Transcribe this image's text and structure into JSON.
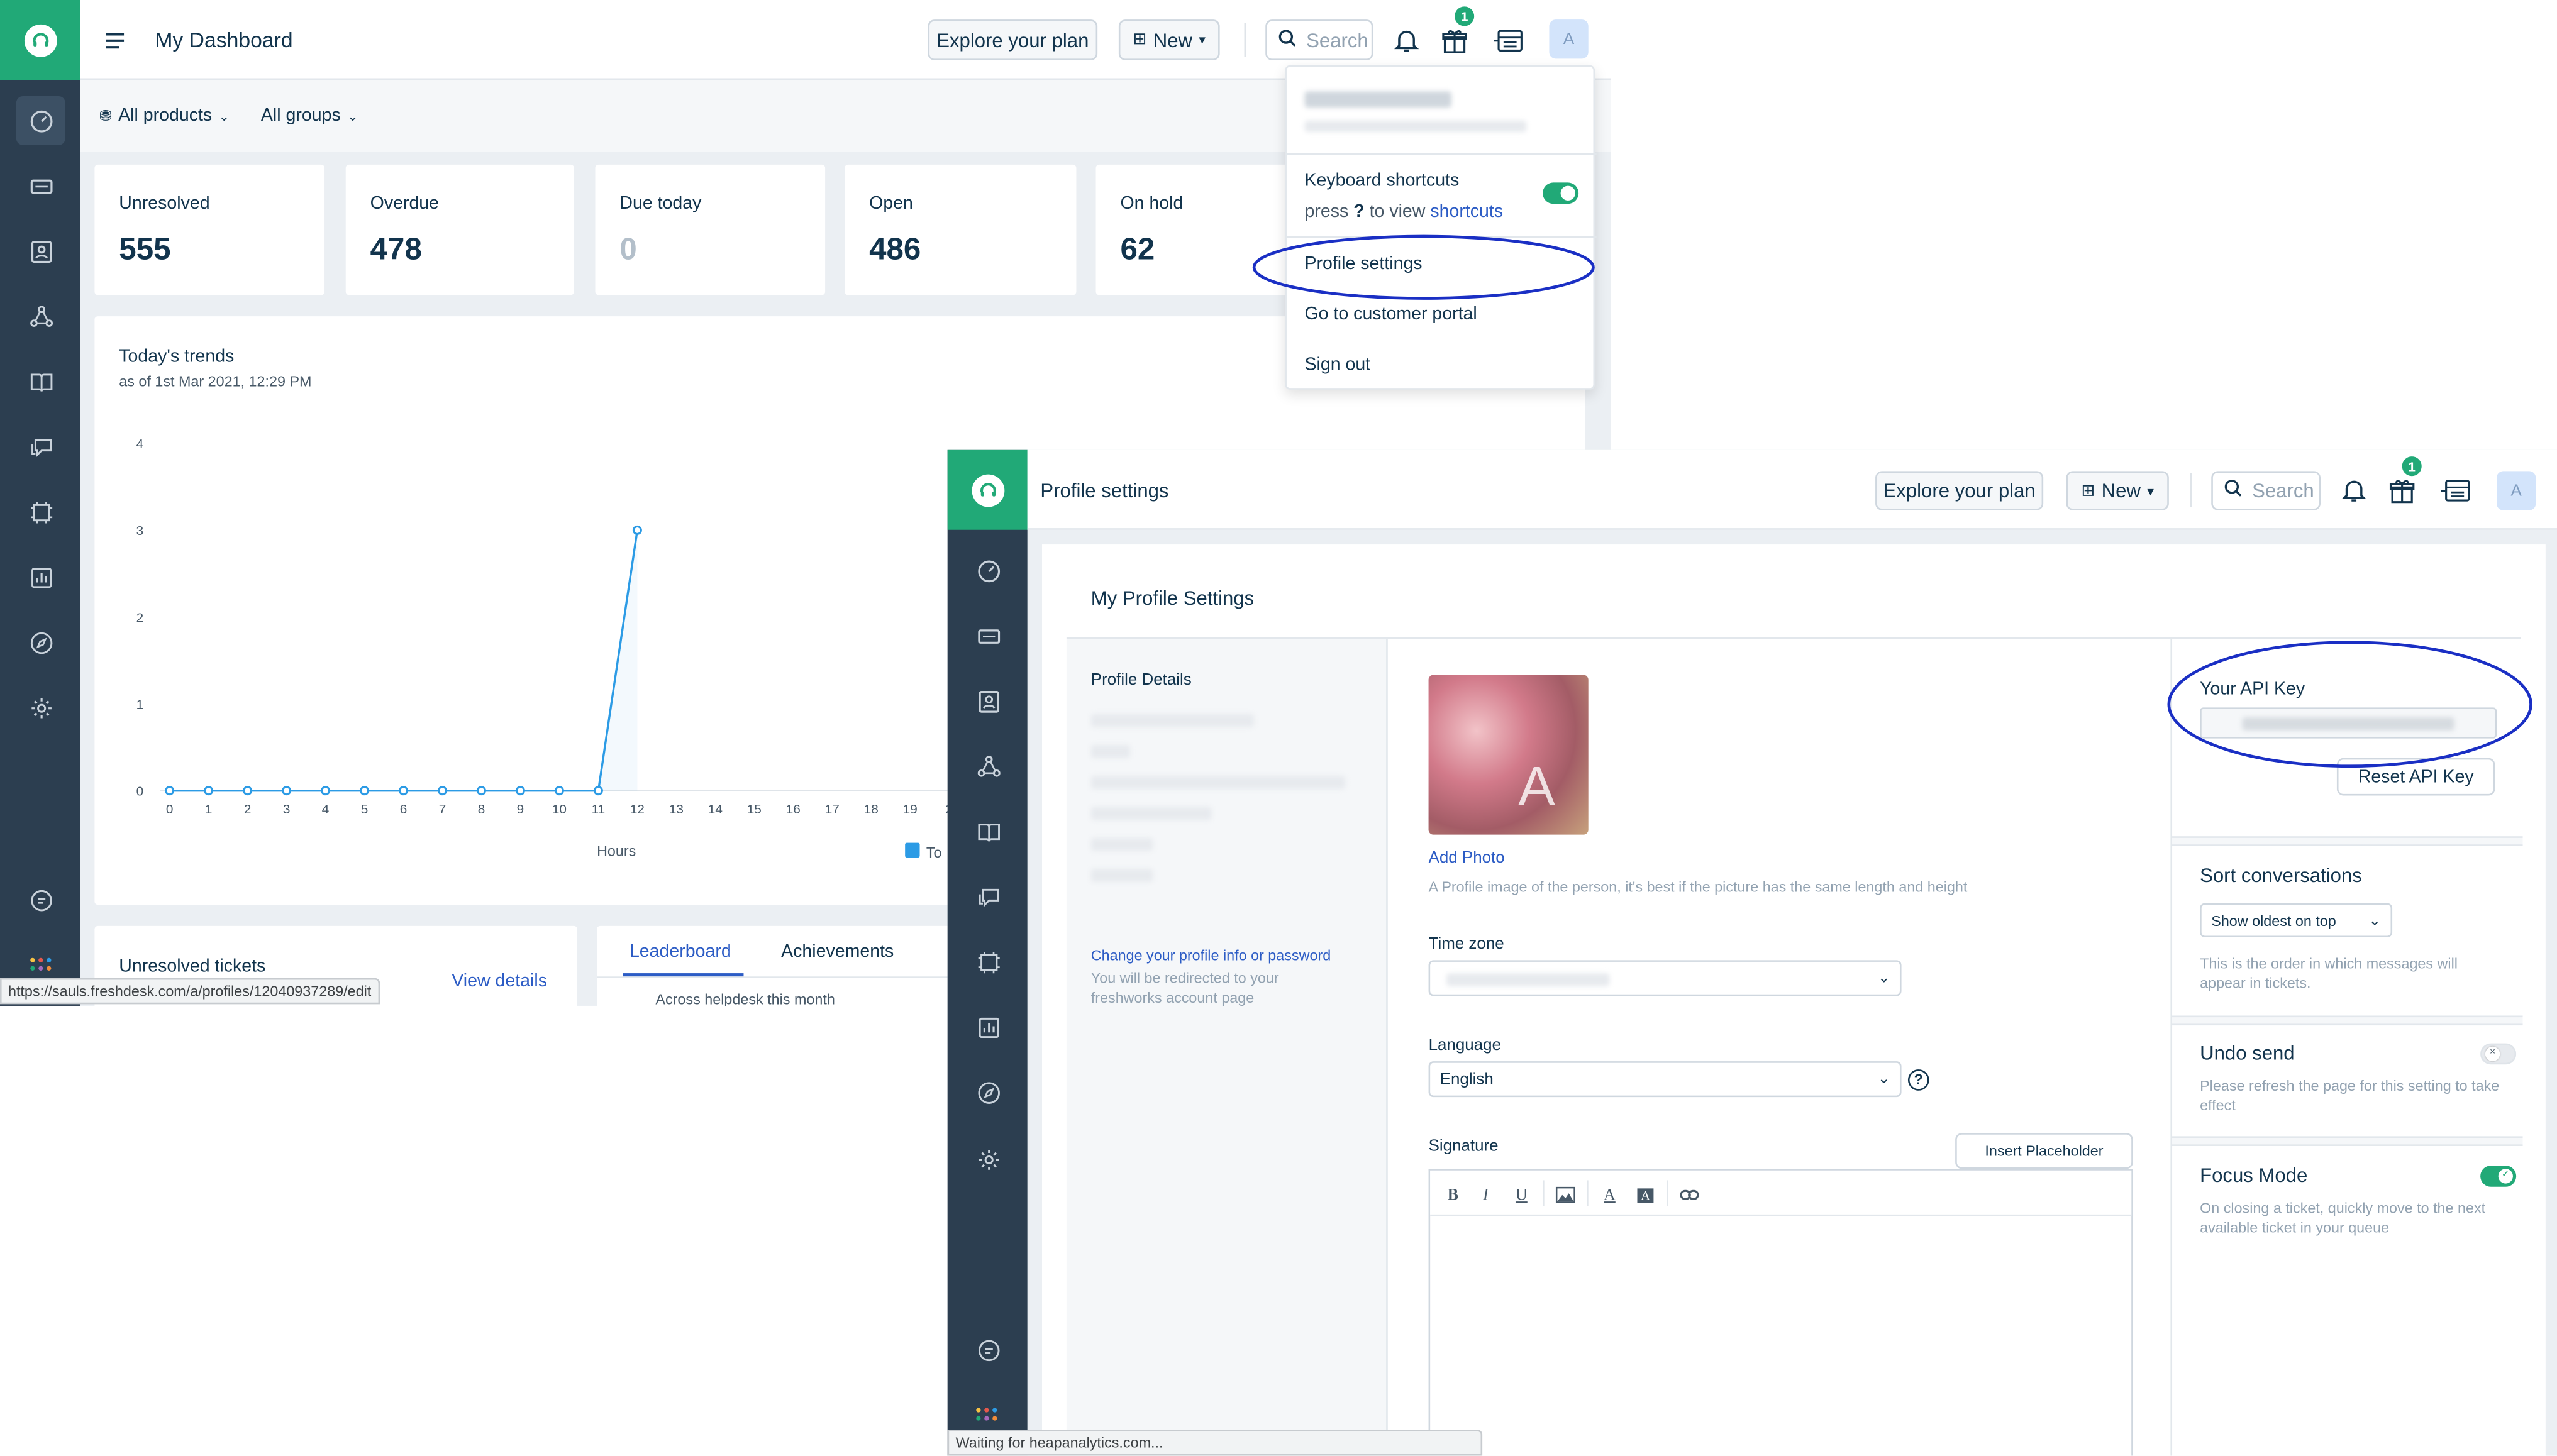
{
  "dashboard": {
    "title": "My Dashboard",
    "explore_label": "Explore your plan",
    "new_label": "New",
    "search_placeholder": "Search",
    "gift_badge": "1",
    "avatar_letter": "A",
    "filters": {
      "products": "All products",
      "groups": "All groups"
    },
    "stats": [
      {
        "label": "Unresolved",
        "value": "555"
      },
      {
        "label": "Overdue",
        "value": "478"
      },
      {
        "label": "Due today",
        "value": "0"
      },
      {
        "label": "Open",
        "value": "486"
      },
      {
        "label": "On hold",
        "value": "62"
      }
    ],
    "trends_title": "Today's trends",
    "trends_subtitle": "as of 1st Mar 2021, 12:29 PM",
    "legend_label": "To",
    "unresolved_title": "Unresolved tickets",
    "view_details": "View details",
    "tabs": {
      "leaderboard": "Leaderboard",
      "achievements": "Achievements"
    },
    "leaderboard_sub": "Across helpdesk this month",
    "status_url": "https://sauls.freshdesk.com/a/profiles/12040937289/edit"
  },
  "chart_data": {
    "type": "line",
    "title": "Today's trends",
    "subtitle": "as of 1st Mar 2021, 12:29 PM",
    "xlabel": "Hours",
    "ylabel": "",
    "x": [
      "0",
      "1",
      "2",
      "3",
      "4",
      "5",
      "6",
      "7",
      "8",
      "9",
      "10",
      "11",
      "12",
      "13",
      "14",
      "15",
      "16",
      "17",
      "18",
      "19",
      "2"
    ],
    "ylim": [
      0,
      4
    ],
    "y_ticks": [
      "0",
      "1",
      "2",
      "3",
      "4"
    ],
    "series": [
      {
        "name": "To",
        "color": "#2c9be5",
        "x": [
          0,
          1,
          2,
          3,
          4,
          5,
          6,
          7,
          8,
          9,
          10,
          11,
          12
        ],
        "values": [
          0,
          0,
          0,
          0,
          0,
          0,
          0,
          0,
          0,
          0,
          0,
          0,
          3
        ]
      }
    ],
    "grid": false,
    "legend": "bottom-right"
  },
  "dropdown": {
    "keyboard_shortcuts": "Keyboard shortcuts",
    "press": "press",
    "key": "?",
    "to_view": "to view",
    "shortcuts_link": "shortcuts",
    "keyboard_shortcuts_enabled": true,
    "profile_settings": "Profile settings",
    "customer_portal": "Go to customer portal",
    "sign_out": "Sign out"
  },
  "profile": {
    "header_title": "Profile settings",
    "explore_label": "Explore your plan",
    "new_label": "New",
    "search_placeholder": "Search",
    "gift_badge": "1",
    "avatar_letter": "A",
    "page_title": "My Profile Settings",
    "details_heading": "Profile Details",
    "change_link": "Change your profile info or password",
    "redirect_note": "You will be redirected to your freshworks account page",
    "photo_letter": "A",
    "add_photo": "Add Photo",
    "photo_hint": "A Profile image of the person, it's best if the picture has the same length and height",
    "timezone_label": "Time zone",
    "language_label": "Language",
    "language_value": "English",
    "help_icon": "?",
    "signature_label": "Signature",
    "insert_placeholder": "Insert Placeholder",
    "api_key_label": "Your API Key",
    "reset_api_key": "Reset API Key",
    "sort_title": "Sort conversations",
    "sort_value": "Show oldest on top",
    "sort_desc": "This is the order in which messages will appear in tickets.",
    "undo_title": "Undo send",
    "undo_enabled": false,
    "undo_desc": "Please refresh the page for this setting to take effect",
    "focus_title": "Focus Mode",
    "focus_enabled": true,
    "focus_desc": "On closing a ticket, quickly move to the next available ticket in your queue",
    "status_text": "Waiting for heapanalytics.com..."
  },
  "colors": {
    "brand": "#21a977",
    "sidebar": "#2c3e50",
    "link": "#2c5cc5",
    "annotation": "#1a2fc4",
    "line": "#2c9be5"
  }
}
